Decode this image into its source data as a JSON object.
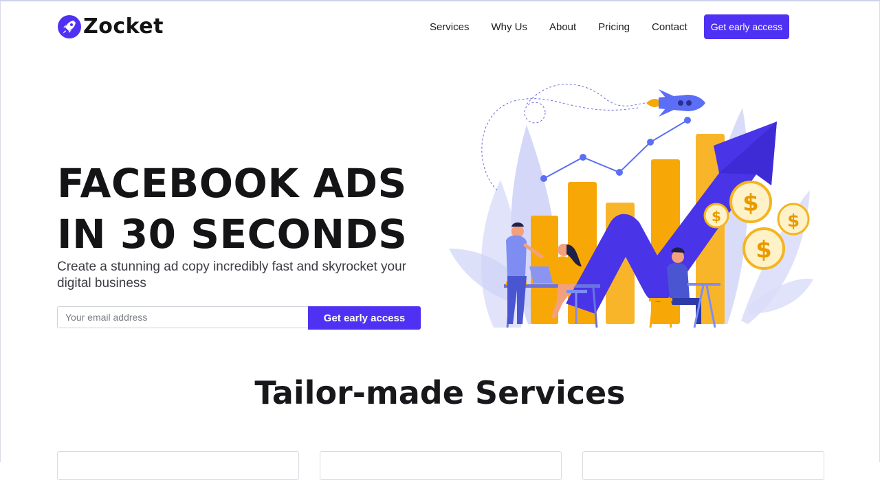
{
  "brand": {
    "name": "Zocket",
    "logo_icon": "rocket-icon",
    "accent": "#4f31f3"
  },
  "nav": {
    "links": [
      "Services",
      "Why Us",
      "About",
      "Pricing",
      "Contact"
    ],
    "cta": "Get early access"
  },
  "hero": {
    "title_line1": "FACEBOOK ADS",
    "title_line2": "IN 30 SECONDS",
    "subtitle": "Create a stunning ad copy incredibly fast and skyrocket your digital business",
    "email_placeholder": "Your email address",
    "cta": "Get early access",
    "illustration": "growth-chart-team-illustration"
  },
  "services": {
    "title": "Tailor-made Services"
  }
}
